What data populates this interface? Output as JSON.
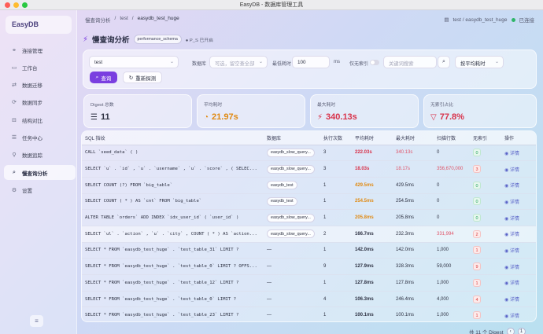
{
  "window": {
    "title": "EasyDB - 数据库管理工具"
  },
  "sidebar": {
    "brand": "EasyDB",
    "items": [
      {
        "label": "连接管理",
        "icon": "link-icon"
      },
      {
        "label": "工作台",
        "icon": "terminal-icon"
      },
      {
        "label": "数据迁移",
        "icon": "migrate-icon"
      },
      {
        "label": "数据同步",
        "icon": "sync-icon"
      },
      {
        "label": "结构对比",
        "icon": "compare-icon"
      },
      {
        "label": "任务中心",
        "icon": "tasks-icon"
      },
      {
        "label": "数据追踪",
        "icon": "trace-icon"
      },
      {
        "label": "慢查询分析",
        "icon": "search-icon",
        "active": true
      },
      {
        "label": "设置",
        "icon": "gear-icon"
      }
    ]
  },
  "breadcrumb": {
    "root": "慢查询分析",
    "sep": "/",
    "db": "test",
    "schema": "easydb_test_huge"
  },
  "connection": {
    "label": "test / easydb_test_huge",
    "status": "已连接"
  },
  "page": {
    "title": "慢查询分析",
    "schema_badge": "performance_schema",
    "ps_status": "P_S 已开启"
  },
  "filters": {
    "connection_value": "test",
    "db_label": "数据库",
    "db_placeholder": "可选，留空查全部",
    "min_time_label": "最低耗时",
    "min_time_value": "100",
    "min_time_unit": "ms",
    "no_index_label": "仅无索引",
    "keyword_placeholder": "关键词搜索",
    "sort_value": "按平均耗时",
    "query_button": "查询",
    "reset_button": "重新探测"
  },
  "stats": [
    {
      "label": "Digest 总数",
      "value": "11",
      "color": "#2d3142",
      "icon": "list-icon"
    },
    {
      "label": "平均耗时",
      "value": "21.97s",
      "color": "#e08a12",
      "icon": "clock-icon"
    },
    {
      "label": "最大耗时",
      "value": "340.13s",
      "color": "#d8324a",
      "icon": "bolt-icon"
    },
    {
      "label": "无索引占比",
      "value": "77.8%",
      "color": "#d8324a",
      "icon": "filter-icon"
    }
  ],
  "table": {
    "headers": [
      "SQL 指纹",
      "数据库",
      "执行次数",
      "平均耗时",
      "最大耗时",
      "扫描行数",
      "无索引",
      "操作"
    ],
    "rows": [
      {
        "sql": "CALL `seed_data` ( )",
        "db": "easydb_slow_query...",
        "count": "3",
        "avg": "222.03s",
        "max": "340.13s",
        "rows": "0",
        "noidx": "0",
        "action": "详情"
      },
      {
        "sql": "SELECT `u` . `id` , `u` . `username` , `u` . `score` , ( SELEC...",
        "db": "easydb_slow_query...",
        "count": "3",
        "avg": "18.03s",
        "max": "18.17s",
        "rows": "356,670,000",
        "noidx": "3",
        "action": "详情"
      },
      {
        "sql": "SELECT COUNT (?) FROM `big_table`",
        "db": "easydb_test",
        "count": "1",
        "avg": "429.5ms",
        "max": "429.5ms",
        "rows": "0",
        "noidx": "0",
        "action": "详情"
      },
      {
        "sql": "SELECT COUNT ( * ) AS `cnt` FROM `big_table`",
        "db": "easydb_test",
        "count": "1",
        "avg": "254.5ms",
        "max": "254.5ms",
        "rows": "0",
        "noidx": "0",
        "action": "详情"
      },
      {
        "sql": "ALTER TABLE `orders` ADD INDEX `idx_user_id` ( `user_id` )",
        "db": "easydb_slow_query...",
        "count": "1",
        "avg": "205.8ms",
        "max": "205.8ms",
        "rows": "0",
        "noidx": "0",
        "action": "详情"
      },
      {
        "sql": "SELECT `ul` . `action` , `u` . `city` , COUNT ( * ) AS `action...",
        "db": "easydb_slow_query...",
        "count": "2",
        "avg": "166.7ms",
        "max": "232.3ms",
        "rows": "331,994",
        "noidx": "2",
        "action": "详情"
      },
      {
        "sql": "SELECT * FROM `easydb_test_huge` . `test_table_31` LIMIT ?",
        "db": "—",
        "count": "1",
        "avg": "142.0ms",
        "max": "142.0ms",
        "rows": "1,000",
        "noidx": "1",
        "action": "详情"
      },
      {
        "sql": "SELECT * FROM `easydb_test_huge` . `test_table_0` LIMIT ? OFFS...",
        "db": "—",
        "count": "9",
        "avg": "127.9ms",
        "max": "328.3ms",
        "rows": "59,000",
        "noidx": "9",
        "action": "详情"
      },
      {
        "sql": "SELECT * FROM `easydb_test_huge` . `test_table_12` LIMIT ?",
        "db": "—",
        "count": "1",
        "avg": "127.8ms",
        "max": "127.8ms",
        "rows": "1,000",
        "noidx": "1",
        "action": "详情"
      },
      {
        "sql": "SELECT * FROM `easydb_test_huge` . `test_table_0` LIMIT ?",
        "db": "—",
        "count": "4",
        "avg": "106.3ms",
        "max": "246.4ms",
        "rows": "4,000",
        "noidx": "4",
        "action": "详情"
      },
      {
        "sql": "SELECT * FROM `easydb_test_huge` . `test_table_23` LIMIT ?",
        "db": "—",
        "count": "1",
        "avg": "100.1ms",
        "max": "100.1ms",
        "rows": "1,000",
        "noidx": "1",
        "action": "详情"
      }
    ]
  },
  "footer": {
    "total": "共 11 个 Digest",
    "page": "1"
  }
}
